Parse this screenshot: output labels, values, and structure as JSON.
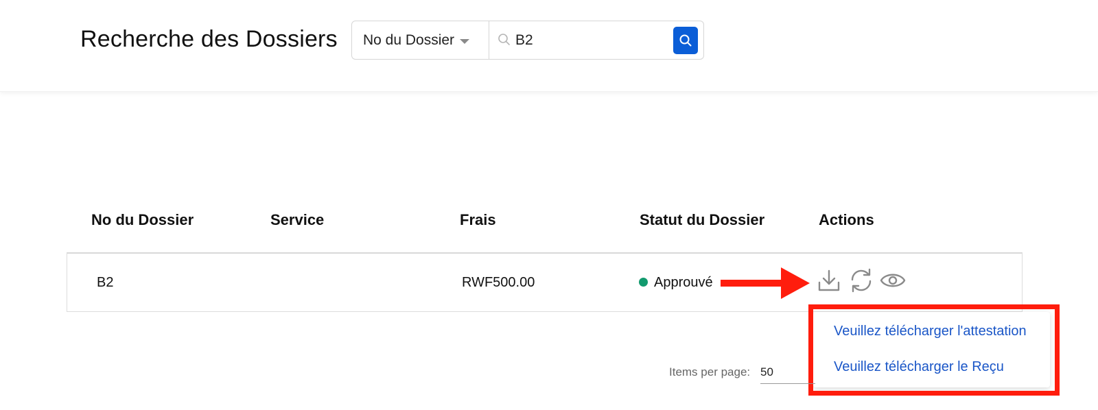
{
  "header": {
    "title": "Recherche des Dossiers",
    "search": {
      "filter_selected": "No du Dossier",
      "query_value": "B2"
    }
  },
  "table": {
    "columns": [
      "No du Dossier",
      "Service",
      "Frais",
      "Statut du Dossier",
      "Actions"
    ],
    "rows": [
      {
        "file_no": "B2",
        "service": "",
        "fee": "RWF500.00",
        "status": "Approuvé",
        "status_color": "#129a6e"
      }
    ]
  },
  "download_menu": {
    "items": [
      "Veuillez télécharger l'attestation",
      "Veuillez télécharger le Reçu"
    ]
  },
  "pagination": {
    "items_per_page_label": "Items per page:",
    "items_per_page_value": "50"
  },
  "icons": {
    "filter_caret": "chevron-down-icon",
    "search_glass": "search-icon",
    "search_button": "search-icon",
    "download": "download-icon",
    "refresh": "refresh-icon",
    "view": "eye-icon"
  },
  "colors": {
    "accent": "#0b5ed7",
    "link": "#1a56c7",
    "annotation": "#ff1d0d",
    "icon_gray": "#8a8a8a"
  }
}
